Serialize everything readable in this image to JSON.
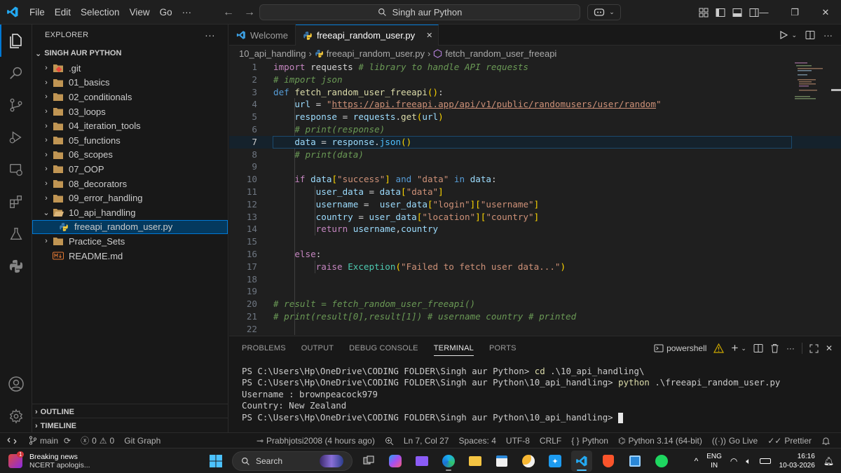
{
  "titlebar": {
    "menus": [
      "File",
      "Edit",
      "Selection",
      "View",
      "Go",
      "···"
    ],
    "search_text": "Singh aur Python",
    "colors": {
      "accent": "#0078d4",
      "logo": "#23a9f2"
    }
  },
  "activity_icons": [
    "explorer-icon",
    "search-icon",
    "source-control-icon",
    "run-debug-icon",
    "remote-explorer-icon",
    "extensions-icon",
    "testing-icon",
    "python-icon",
    "account-icon",
    "settings-gear-icon"
  ],
  "sidebar": {
    "title": "EXPLORER",
    "more": "···",
    "root": "SINGH AUR PYTHON",
    "items": [
      {
        "label": ".git",
        "kind": "folder-git",
        "chevron": "›"
      },
      {
        "label": "01_basics",
        "kind": "folder",
        "chevron": "›"
      },
      {
        "label": "02_conditionals",
        "kind": "folder",
        "chevron": "›"
      },
      {
        "label": "03_loops",
        "kind": "folder",
        "chevron": "›"
      },
      {
        "label": "04_iteration_tools",
        "kind": "folder",
        "chevron": "›"
      },
      {
        "label": "05_functions",
        "kind": "folder",
        "chevron": "›"
      },
      {
        "label": "06_scopes",
        "kind": "folder",
        "chevron": "›"
      },
      {
        "label": "07_OOP",
        "kind": "folder",
        "chevron": "›"
      },
      {
        "label": "08_decorators",
        "kind": "folder",
        "chevron": "›"
      },
      {
        "label": "09_error_handling",
        "kind": "folder",
        "chevron": "›"
      },
      {
        "label": "10_api_handling",
        "kind": "folder-open",
        "chevron": "⌄"
      },
      {
        "label": "freeapi_random_user.py",
        "kind": "python-file",
        "chevron": ""
      },
      {
        "label": "Practice_Sets",
        "kind": "folder",
        "chevron": "›"
      },
      {
        "label": "README.md",
        "kind": "markdown-file",
        "chevron": ""
      }
    ],
    "outline": "OUTLINE",
    "timeline": "TIMELINE"
  },
  "tabs": [
    {
      "label": "Welcome",
      "active": false
    },
    {
      "label": "freeapi_random_user.py",
      "active": true,
      "close": "✕"
    }
  ],
  "breadcrumbs": [
    "10_api_handling",
    "freeapi_random_user.py",
    "fetch_random_user_freeapi"
  ],
  "code": {
    "current_line": 7,
    "lines": [
      {
        "n": "1",
        "tokens": [
          [
            "kw",
            "import"
          ],
          [
            "pl",
            " requests "
          ],
          [
            "cm",
            "# library to handle API requests"
          ]
        ]
      },
      {
        "n": "2",
        "tokens": [
          [
            "cm",
            "# import json"
          ]
        ]
      },
      {
        "n": "3",
        "tokens": [
          [
            "kwb",
            "def"
          ],
          [
            "pl",
            " "
          ],
          [
            "fn",
            "fetch_random_user_freeapi"
          ],
          [
            "br1",
            "()"
          ],
          [
            "pl",
            ":"
          ]
        ]
      },
      {
        "n": "4",
        "tokens": [
          [
            "pl",
            "    "
          ],
          [
            "va",
            "url"
          ],
          [
            "pl",
            " = "
          ],
          [
            "str",
            "\""
          ],
          [
            "url",
            "https://api.freeapi.app/api/v1/public/randomusers/user/random"
          ],
          [
            "str",
            "\""
          ]
        ]
      },
      {
        "n": "5",
        "tokens": [
          [
            "pl",
            "    "
          ],
          [
            "va",
            "response"
          ],
          [
            "pl",
            " = "
          ],
          [
            "va",
            "requests"
          ],
          [
            "pl",
            "."
          ],
          [
            "fn",
            "get"
          ],
          [
            "br1",
            "("
          ],
          [
            "va",
            "url"
          ],
          [
            "br1",
            ")"
          ]
        ]
      },
      {
        "n": "6",
        "tokens": [
          [
            "pl",
            "    "
          ],
          [
            "cm",
            "# print(response)"
          ]
        ]
      },
      {
        "n": "7",
        "tokens": [
          [
            "pl",
            "    "
          ],
          [
            "va",
            "data"
          ],
          [
            "pl",
            " = "
          ],
          [
            "va",
            "response"
          ],
          [
            "pl",
            "."
          ],
          [
            "mt",
            "json"
          ],
          [
            "br1",
            "()"
          ]
        ]
      },
      {
        "n": "8",
        "tokens": [
          [
            "pl",
            "    "
          ],
          [
            "cm",
            "# print(data)"
          ]
        ]
      },
      {
        "n": "9",
        "tokens": []
      },
      {
        "n": "10",
        "tokens": [
          [
            "pl",
            "    "
          ],
          [
            "kw",
            "if"
          ],
          [
            "pl",
            " "
          ],
          [
            "va",
            "data"
          ],
          [
            "br1",
            "["
          ],
          [
            "str",
            "\"success\""
          ],
          [
            "br1",
            "]"
          ],
          [
            "pl",
            " "
          ],
          [
            "kwb",
            "and"
          ],
          [
            "pl",
            " "
          ],
          [
            "str",
            "\"data\""
          ],
          [
            "pl",
            " "
          ],
          [
            "kwb",
            "in"
          ],
          [
            "pl",
            " "
          ],
          [
            "va",
            "data"
          ],
          [
            "pl",
            ":"
          ]
        ]
      },
      {
        "n": "11",
        "tokens": [
          [
            "pl",
            "        "
          ],
          [
            "va",
            "user_data"
          ],
          [
            "pl",
            " = "
          ],
          [
            "va",
            "data"
          ],
          [
            "br1",
            "["
          ],
          [
            "str",
            "\"data\""
          ],
          [
            "br1",
            "]"
          ]
        ]
      },
      {
        "n": "12",
        "tokens": [
          [
            "pl",
            "        "
          ],
          [
            "va",
            "username"
          ],
          [
            "pl",
            " =  "
          ],
          [
            "va",
            "user_data"
          ],
          [
            "br1",
            "["
          ],
          [
            "str",
            "\"login\""
          ],
          [
            "br1",
            "]["
          ],
          [
            "str",
            "\"username\""
          ],
          [
            "br1",
            "]"
          ]
        ]
      },
      {
        "n": "13",
        "tokens": [
          [
            "pl",
            "        "
          ],
          [
            "va",
            "country"
          ],
          [
            "pl",
            " = "
          ],
          [
            "va",
            "user_data"
          ],
          [
            "br1",
            "["
          ],
          [
            "str",
            "\"location\""
          ],
          [
            "br1",
            "]["
          ],
          [
            "str",
            "\"country\""
          ],
          [
            "br1",
            "]"
          ]
        ]
      },
      {
        "n": "14",
        "tokens": [
          [
            "pl",
            "        "
          ],
          [
            "kw",
            "return"
          ],
          [
            "pl",
            " "
          ],
          [
            "va",
            "username"
          ],
          [
            "pl",
            ","
          ],
          [
            "va",
            "country"
          ]
        ]
      },
      {
        "n": "15",
        "tokens": []
      },
      {
        "n": "16",
        "tokens": [
          [
            "pl",
            "    "
          ],
          [
            "kw",
            "else"
          ],
          [
            "pl",
            ":"
          ]
        ]
      },
      {
        "n": "17",
        "tokens": [
          [
            "pl",
            "        "
          ],
          [
            "kw",
            "raise"
          ],
          [
            "pl",
            " "
          ],
          [
            "cl",
            "Exception"
          ],
          [
            "br1",
            "("
          ],
          [
            "str",
            "\"Failed to fetch user data...\""
          ],
          [
            "br1",
            ")"
          ]
        ]
      },
      {
        "n": "18",
        "tokens": []
      },
      {
        "n": "19",
        "tokens": []
      },
      {
        "n": "20",
        "tokens": [
          [
            "cm",
            "# result = fetch_random_user_freeapi()"
          ]
        ]
      },
      {
        "n": "21",
        "tokens": [
          [
            "cm",
            "# print(result[0],result[1]) # username country # printed"
          ]
        ]
      },
      {
        "n": "22",
        "tokens": []
      }
    ]
  },
  "panel": {
    "tabs": [
      "PROBLEMS",
      "OUTPUT",
      "DEBUG CONSOLE",
      "TERMINAL",
      "PORTS"
    ],
    "active_tab": "TERMINAL",
    "shell": "powershell",
    "terminal": [
      {
        "prompt": "PS C:\\Users\\Hp\\OneDrive\\CODING FOLDER\\Singh aur Python> ",
        "cmd": "cd",
        "args": " .\\10_api_handling\\"
      },
      {
        "prompt": "PS C:\\Users\\Hp\\OneDrive\\CODING FOLDER\\Singh aur Python\\10_api_handling> ",
        "cmd": "python",
        "args": " .\\freeapi_random_user.py"
      },
      {
        "prompt": "Username : brownpeacock979",
        "cmd": "",
        "args": ""
      },
      {
        "prompt": "Country: New Zealand",
        "cmd": "",
        "args": ""
      },
      {
        "prompt": "PS C:\\Users\\Hp\\OneDrive\\CODING FOLDER\\Singh aur Python\\10_api_handling> ",
        "cmd": "",
        "args": "",
        "cursor": true
      }
    ]
  },
  "statusbar": {
    "branch": "main",
    "errors": "0",
    "warnings": "0",
    "git_graph": "Git Graph",
    "blame": "Prabhjotsi2008 (4 hours ago)",
    "position": "Ln 7, Col 27",
    "spaces": "Spaces: 4",
    "encoding": "UTF-8",
    "eol": "CRLF",
    "language": "Python",
    "interpreter": "Python 3.14 (64-bit)",
    "golive": "Go Live",
    "prettier": "Prettier"
  },
  "taskbar": {
    "news_badge": "1",
    "news_title": "Breaking news",
    "news_sub": "NCERT apologis...",
    "search_label": "Search",
    "apps": [
      "task-view-icon",
      "copilot-app-icon",
      "file-explorer-app-icon",
      "edge-browser-icon",
      "folder-app-icon",
      "store-icon",
      "weather-icon",
      "twitter-icon",
      "vscode-app-icon",
      "brave-browser-icon",
      "notes-app-icon",
      "spotify-icon"
    ],
    "lang_top": "ENG",
    "lang_bottom": "IN",
    "time": "16:16",
    "date": "10-03-2026"
  }
}
